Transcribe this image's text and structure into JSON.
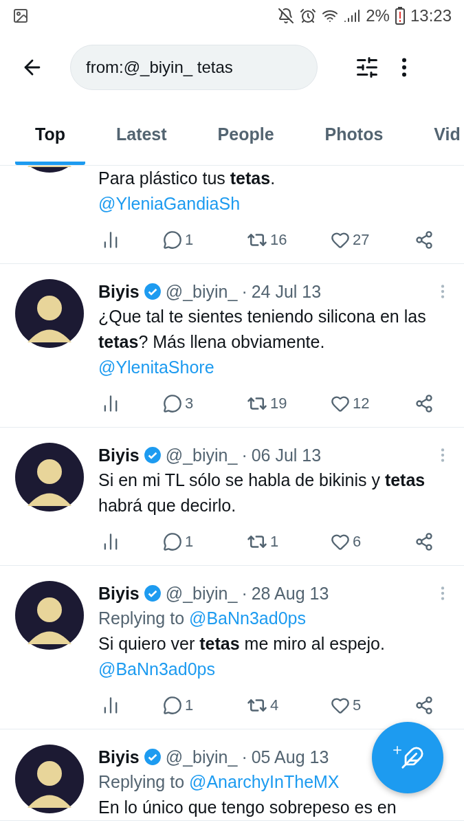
{
  "status_bar": {
    "battery": "2%",
    "time": "13:23"
  },
  "search": {
    "value": "from:@_biyin_ tetas"
  },
  "tabs": [
    {
      "label": "Top",
      "selected": true
    },
    {
      "label": "Latest",
      "selected": false
    },
    {
      "label": "People",
      "selected": false
    },
    {
      "label": "Photos",
      "selected": false
    },
    {
      "label": "Vid",
      "selected": false
    }
  ],
  "tweets": [
    {
      "text": "Para plástico tus **tetas**.",
      "mention": "@YleniaGandiaSh",
      "replies": "1",
      "retweets": "16",
      "likes": "27"
    },
    {
      "name": "Biyis",
      "verified": true,
      "handle": "@_biyin_",
      "separator": "·",
      "date": "24 Jul 13",
      "text": "¿Que tal te sientes teniendo silicona en las **tetas**? Más llena obviamente.",
      "mention": "@YlenitaShore",
      "replies": "3",
      "retweets": "19",
      "likes": "12"
    },
    {
      "name": "Biyis",
      "verified": true,
      "handle": "@_biyin_",
      "separator": "·",
      "date": "06 Jul 13",
      "text": "Si en mi TL sólo se habla de bikinis y **tetas** habrá que decirlo.",
      "replies": "1",
      "retweets": "1",
      "likes": "6"
    },
    {
      "name": "Biyis",
      "verified": true,
      "handle": "@_biyin_",
      "separator": "·",
      "date": "28 Aug 13",
      "replying_label": "Replying to",
      "replying_to": "@BaNn3ad0ps",
      "text": "Si quiero ver **tetas** me miro al espejo.",
      "mention": "@BaNn3ad0ps",
      "replies": "1",
      "retweets": "4",
      "likes": "5"
    },
    {
      "name": "Biyis",
      "verified": true,
      "handle": "@_biyin_",
      "separator": "·",
      "date": "05 Aug 13",
      "replying_label": "Replying to",
      "replying_to": "@AnarchyInTheMX",
      "text": "En lo único que tengo sobrepeso es en"
    }
  ]
}
